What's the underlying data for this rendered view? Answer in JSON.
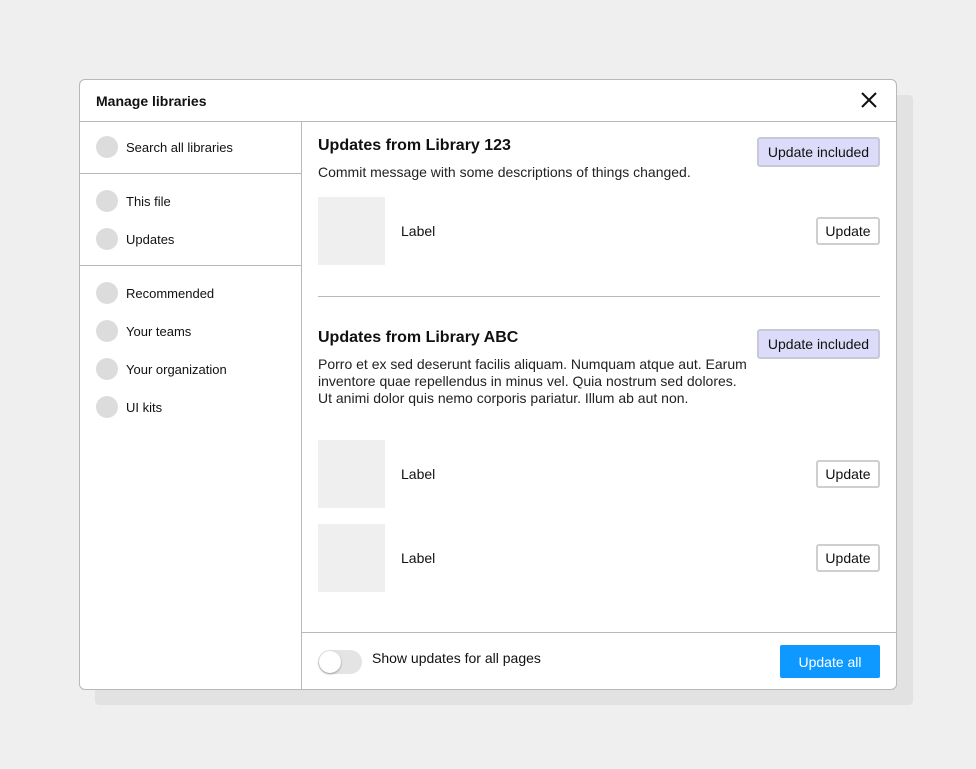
{
  "dialog": {
    "title": "Manage libraries"
  },
  "sidebar": {
    "search": {
      "label": "Search all libraries"
    },
    "group1": [
      {
        "label": "This file"
      },
      {
        "label": "Updates"
      }
    ],
    "group2": [
      {
        "label": "Recommended"
      },
      {
        "label": "Your teams"
      },
      {
        "label": "Your organization"
      },
      {
        "label": "UI kits"
      }
    ]
  },
  "sections": [
    {
      "title": "Updates from Library 123",
      "description": "Commit message with some descriptions of things changed.",
      "badge": "Update included",
      "items": [
        {
          "label": "Label",
          "button": "Update"
        }
      ]
    },
    {
      "title": "Updates from Library ABC",
      "description": "Porro et ex sed deserunt facilis aliquam. Numquam atque aut. Earum inventore quae repellendus in minus vel. Quia nostrum sed dolores. Ut animi dolor quis nemo corporis pariatur. Illum ab aut non.",
      "badge": "Update included",
      "items": [
        {
          "label": "Label",
          "button": "Update"
        },
        {
          "label": "Label",
          "button": "Update"
        }
      ]
    }
  ],
  "footer": {
    "toggle_label": "Show updates for all pages",
    "toggle_on": false,
    "primary_button": "Update all"
  },
  "colors": {
    "accent": "#0d99ff",
    "badge_bg": "#dcdcfa",
    "placeholder": "#dcdcdc"
  },
  "icons": {
    "close": "close-icon"
  }
}
